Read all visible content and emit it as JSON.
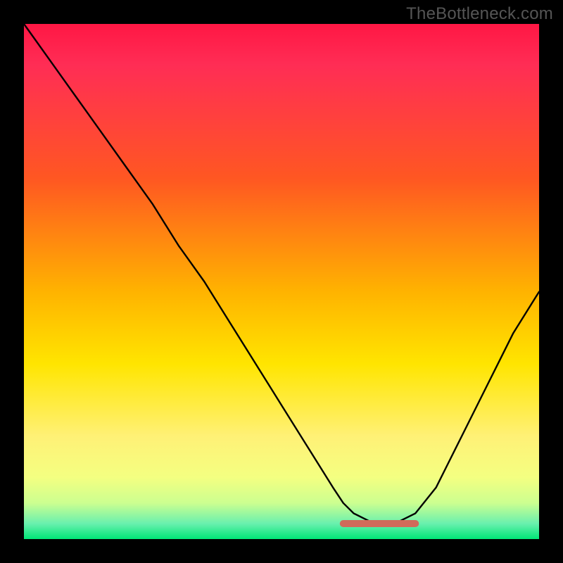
{
  "watermark": "TheBottleneck.com",
  "chart_data": {
    "type": "line",
    "title": "",
    "xlabel": "",
    "ylabel": "",
    "xlim": [
      0,
      100
    ],
    "ylim": [
      0,
      100
    ],
    "grid": false,
    "legend": false,
    "series": [
      {
        "name": "curve",
        "x": [
          0,
          5,
          10,
          15,
          20,
          25,
          30,
          35,
          40,
          45,
          50,
          55,
          60,
          62,
          64,
          66,
          68,
          70,
          72,
          74,
          76,
          80,
          85,
          90,
          95,
          100
        ],
        "values": [
          100,
          93,
          86,
          79,
          72,
          65,
          57,
          50,
          42,
          34,
          26,
          18,
          10,
          7,
          5,
          4,
          3,
          3,
          3,
          4,
          5,
          10,
          20,
          30,
          40,
          48
        ]
      }
    ],
    "annotations": [
      {
        "name": "optimal-flat-segment",
        "x_start": 62,
        "x_end": 76,
        "y": 3,
        "color": "#d16a5a"
      }
    ],
    "background_gradient": {
      "direction": "vertical",
      "stops": [
        {
          "pos": 0,
          "color": "#ff1744"
        },
        {
          "pos": 30,
          "color": "#ff5722"
        },
        {
          "pos": 52,
          "color": "#ffb300"
        },
        {
          "pos": 66,
          "color": "#ffe500"
        },
        {
          "pos": 88,
          "color": "#f4ff81"
        },
        {
          "pos": 100,
          "color": "#00e676"
        }
      ]
    }
  }
}
